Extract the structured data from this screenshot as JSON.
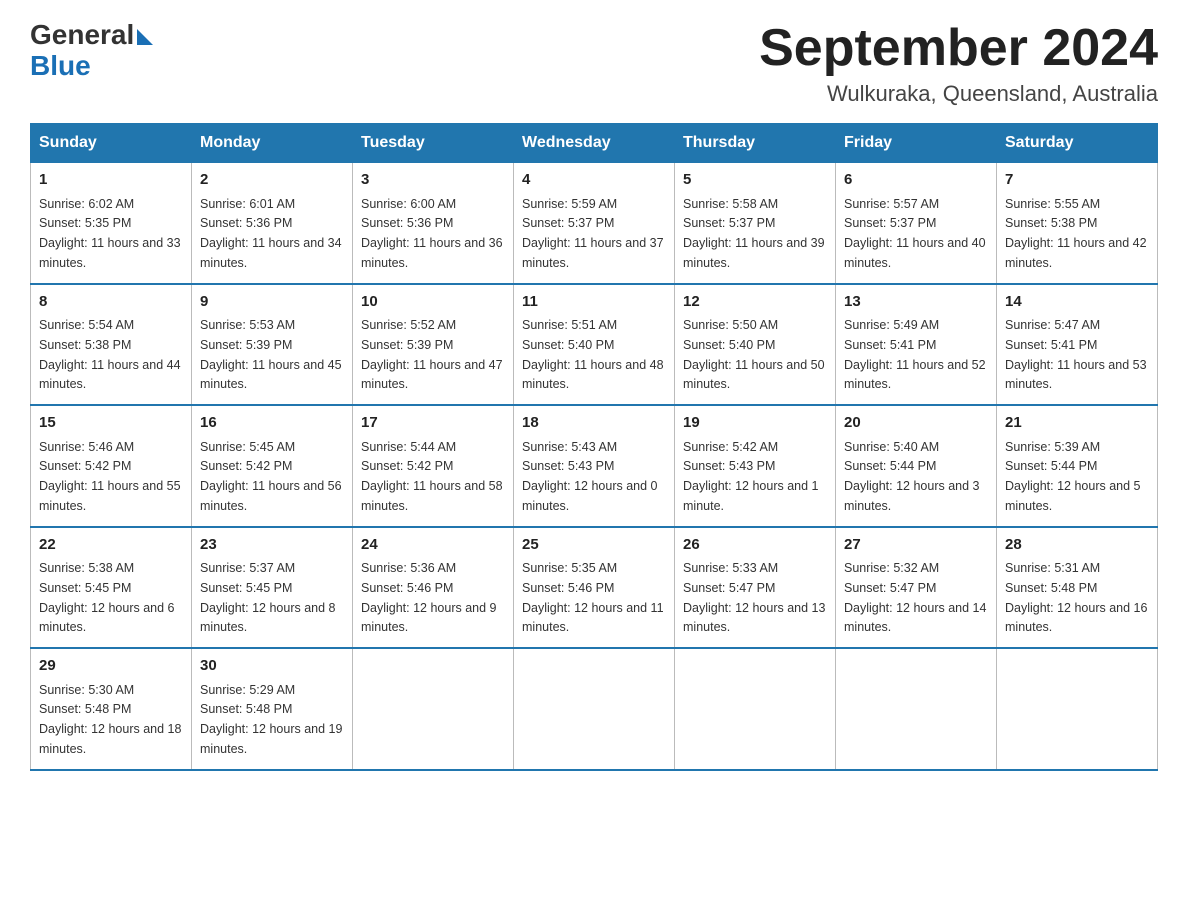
{
  "logo": {
    "general": "General",
    "blue": "Blue",
    "arrow": "▶"
  },
  "title": "September 2024",
  "location": "Wulkuraka, Queensland, Australia",
  "days_of_week": [
    "Sunday",
    "Monday",
    "Tuesday",
    "Wednesday",
    "Thursday",
    "Friday",
    "Saturday"
  ],
  "weeks": [
    [
      {
        "day": "1",
        "sunrise": "6:02 AM",
        "sunset": "5:35 PM",
        "daylight": "11 hours and 33 minutes."
      },
      {
        "day": "2",
        "sunrise": "6:01 AM",
        "sunset": "5:36 PM",
        "daylight": "11 hours and 34 minutes."
      },
      {
        "day": "3",
        "sunrise": "6:00 AM",
        "sunset": "5:36 PM",
        "daylight": "11 hours and 36 minutes."
      },
      {
        "day": "4",
        "sunrise": "5:59 AM",
        "sunset": "5:37 PM",
        "daylight": "11 hours and 37 minutes."
      },
      {
        "day": "5",
        "sunrise": "5:58 AM",
        "sunset": "5:37 PM",
        "daylight": "11 hours and 39 minutes."
      },
      {
        "day": "6",
        "sunrise": "5:57 AM",
        "sunset": "5:37 PM",
        "daylight": "11 hours and 40 minutes."
      },
      {
        "day": "7",
        "sunrise": "5:55 AM",
        "sunset": "5:38 PM",
        "daylight": "11 hours and 42 minutes."
      }
    ],
    [
      {
        "day": "8",
        "sunrise": "5:54 AM",
        "sunset": "5:38 PM",
        "daylight": "11 hours and 44 minutes."
      },
      {
        "day": "9",
        "sunrise": "5:53 AM",
        "sunset": "5:39 PM",
        "daylight": "11 hours and 45 minutes."
      },
      {
        "day": "10",
        "sunrise": "5:52 AM",
        "sunset": "5:39 PM",
        "daylight": "11 hours and 47 minutes."
      },
      {
        "day": "11",
        "sunrise": "5:51 AM",
        "sunset": "5:40 PM",
        "daylight": "11 hours and 48 minutes."
      },
      {
        "day": "12",
        "sunrise": "5:50 AM",
        "sunset": "5:40 PM",
        "daylight": "11 hours and 50 minutes."
      },
      {
        "day": "13",
        "sunrise": "5:49 AM",
        "sunset": "5:41 PM",
        "daylight": "11 hours and 52 minutes."
      },
      {
        "day": "14",
        "sunrise": "5:47 AM",
        "sunset": "5:41 PM",
        "daylight": "11 hours and 53 minutes."
      }
    ],
    [
      {
        "day": "15",
        "sunrise": "5:46 AM",
        "sunset": "5:42 PM",
        "daylight": "11 hours and 55 minutes."
      },
      {
        "day": "16",
        "sunrise": "5:45 AM",
        "sunset": "5:42 PM",
        "daylight": "11 hours and 56 minutes."
      },
      {
        "day": "17",
        "sunrise": "5:44 AM",
        "sunset": "5:42 PM",
        "daylight": "11 hours and 58 minutes."
      },
      {
        "day": "18",
        "sunrise": "5:43 AM",
        "sunset": "5:43 PM",
        "daylight": "12 hours and 0 minutes."
      },
      {
        "day": "19",
        "sunrise": "5:42 AM",
        "sunset": "5:43 PM",
        "daylight": "12 hours and 1 minute."
      },
      {
        "day": "20",
        "sunrise": "5:40 AM",
        "sunset": "5:44 PM",
        "daylight": "12 hours and 3 minutes."
      },
      {
        "day": "21",
        "sunrise": "5:39 AM",
        "sunset": "5:44 PM",
        "daylight": "12 hours and 5 minutes."
      }
    ],
    [
      {
        "day": "22",
        "sunrise": "5:38 AM",
        "sunset": "5:45 PM",
        "daylight": "12 hours and 6 minutes."
      },
      {
        "day": "23",
        "sunrise": "5:37 AM",
        "sunset": "5:45 PM",
        "daylight": "12 hours and 8 minutes."
      },
      {
        "day": "24",
        "sunrise": "5:36 AM",
        "sunset": "5:46 PM",
        "daylight": "12 hours and 9 minutes."
      },
      {
        "day": "25",
        "sunrise": "5:35 AM",
        "sunset": "5:46 PM",
        "daylight": "12 hours and 11 minutes."
      },
      {
        "day": "26",
        "sunrise": "5:33 AM",
        "sunset": "5:47 PM",
        "daylight": "12 hours and 13 minutes."
      },
      {
        "day": "27",
        "sunrise": "5:32 AM",
        "sunset": "5:47 PM",
        "daylight": "12 hours and 14 minutes."
      },
      {
        "day": "28",
        "sunrise": "5:31 AM",
        "sunset": "5:48 PM",
        "daylight": "12 hours and 16 minutes."
      }
    ],
    [
      {
        "day": "29",
        "sunrise": "5:30 AM",
        "sunset": "5:48 PM",
        "daylight": "12 hours and 18 minutes."
      },
      {
        "day": "30",
        "sunrise": "5:29 AM",
        "sunset": "5:48 PM",
        "daylight": "12 hours and 19 minutes."
      },
      null,
      null,
      null,
      null,
      null
    ]
  ]
}
